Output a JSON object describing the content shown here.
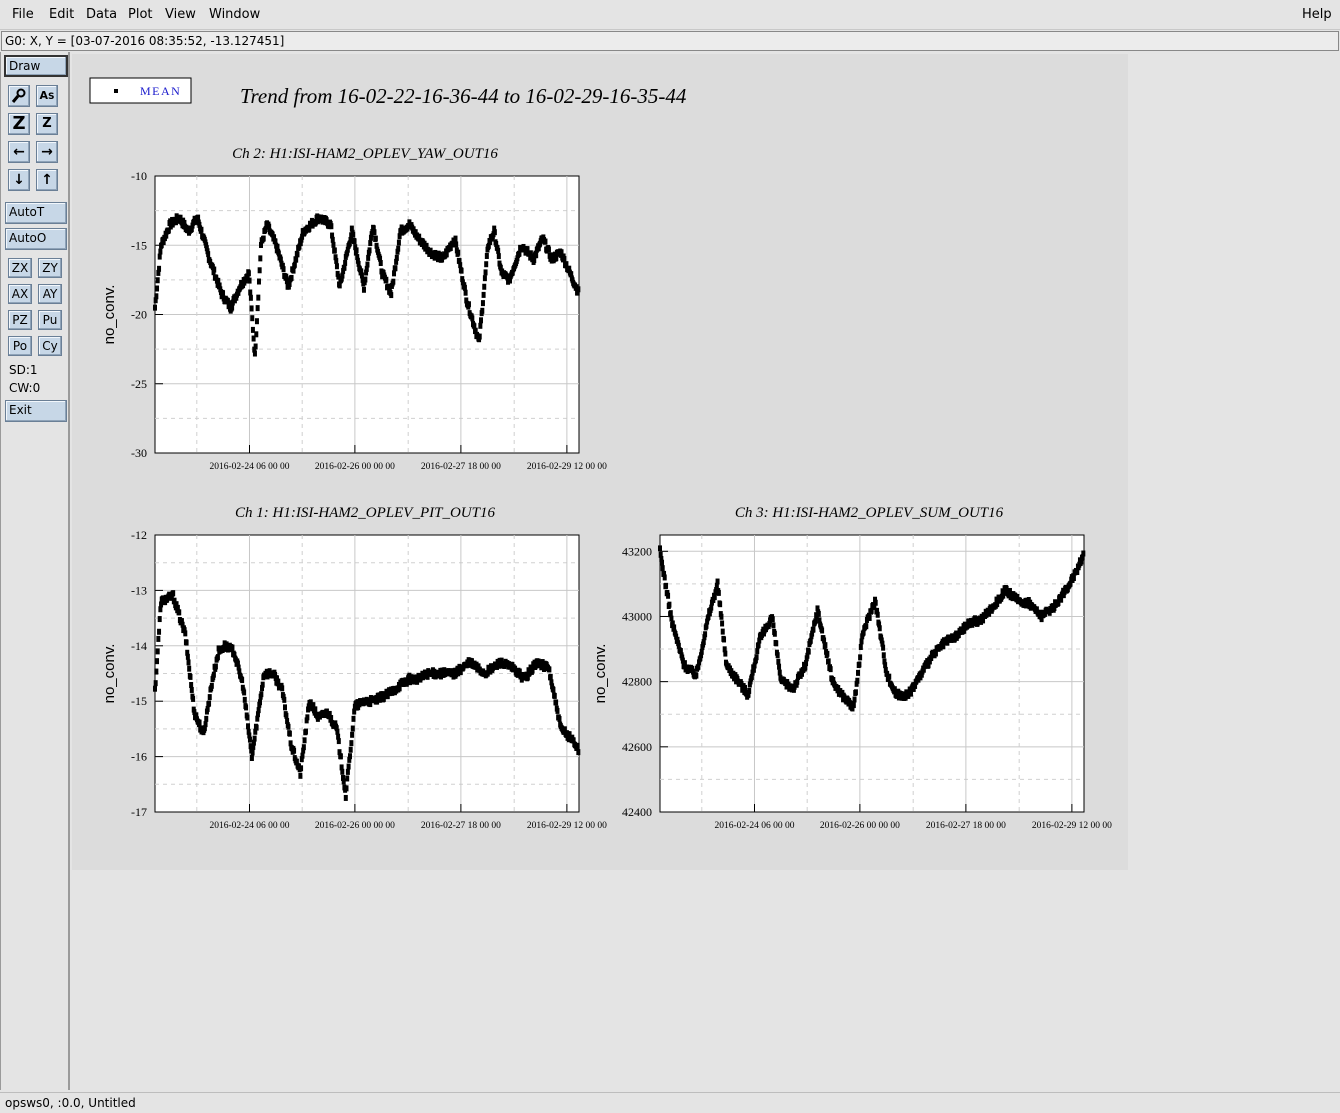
{
  "menu": {
    "file": "File",
    "edit": "Edit",
    "data": "Data",
    "plot": "Plot",
    "view": "View",
    "window": "Window",
    "help": "Help"
  },
  "status_top": "G0: X, Y = [03-07-2016 08:35:52, -13.127451]",
  "status_bottom": "opsws0, :0.0, Untitled",
  "toolbar": {
    "draw": "Draw",
    "icons": [
      "magnifier-icon",
      "autoscale-text-icon",
      "zoom-in-icon",
      "zoom-out-icon",
      "arrow-left-icon",
      "arrow-right-icon",
      "arrow-down-icon",
      "arrow-up-icon"
    ],
    "autot": "AutoT",
    "autoo": "AutoO",
    "zx": "ZX",
    "zy": "ZY",
    "ax": "AX",
    "ay": "AY",
    "pz": "PZ",
    "pu": "Pu",
    "po": "Po",
    "cy": "Cy",
    "sd": "SD:1",
    "cw": "CW:0",
    "exit": "Exit"
  },
  "plot": {
    "title": "Trend from 16-02-22-16-36-44 to 16-02-29-16-35-44",
    "legend": "MEAN"
  },
  "chart_data": [
    {
      "type": "scatter",
      "title": "Ch 2: H1:ISI-HAM2_OPLEV_YAW_OUT16",
      "ylabel": "no_conv.",
      "xlabel": "",
      "xticks": [
        "2016-02-24 06 00 00",
        "2016-02-26 00 00 00",
        "2016-02-27 18 00 00",
        "2016-02-29 12 00 00"
      ],
      "yticks": [
        -10,
        -15,
        -20,
        -25,
        -30
      ],
      "ylim": [
        -30,
        -10
      ],
      "grid": true,
      "series": [
        {
          "name": "MEAN",
          "x_days": [
            0,
            0.1,
            0.25,
            0.4,
            0.55,
            0.7,
            0.9,
            1.1,
            1.25,
            1.4,
            1.55,
            1.65,
            1.75,
            1.85,
            2.0,
            2.2,
            2.45,
            2.7,
            2.9,
            3.05,
            3.25,
            3.45,
            3.6,
            3.75,
            3.9,
            4.05,
            4.2,
            4.35,
            4.55,
            4.75,
            4.95,
            5.15,
            5.35,
            5.5,
            5.6,
            5.72,
            5.85,
            6.05,
            6.25,
            6.4,
            6.55,
            6.7,
            6.85,
            7.0
          ],
          "values": [
            -19.5,
            -15,
            -13.5,
            -13,
            -14,
            -13,
            -16,
            -18.5,
            -19.5,
            -18,
            -17,
            -23,
            -15,
            -13.5,
            -15,
            -18,
            -14,
            -13,
            -13.5,
            -18,
            -14,
            -18,
            -13.5,
            -17,
            -18.5,
            -14,
            -13.5,
            -14.5,
            -15.5,
            -16,
            -14.5,
            -19,
            -22,
            -15,
            -14,
            -17,
            -17.5,
            -15,
            -16,
            -14.5,
            -16,
            -15.5,
            -17,
            -18.5
          ]
        }
      ]
    },
    {
      "type": "scatter",
      "title": "Ch 1: H1:ISI-HAM2_OPLEV_PIT_OUT16",
      "ylabel": "no_conv.",
      "xlabel": "",
      "xticks": [
        "2016-02-24 06 00 00",
        "2016-02-26 00 00 00",
        "2016-02-27 18 00 00",
        "2016-02-29 12 00 00"
      ],
      "yticks": [
        -12,
        -13,
        -14,
        -15,
        -16,
        -17
      ],
      "ylim": [
        -17,
        -12
      ],
      "grid": true,
      "series": [
        {
          "name": "MEAN",
          "x_days": [
            0,
            0.1,
            0.3,
            0.5,
            0.65,
            0.8,
            0.95,
            1.05,
            1.15,
            1.3,
            1.45,
            1.6,
            1.8,
            1.95,
            2.1,
            2.25,
            2.4,
            2.55,
            2.7,
            2.85,
            3.0,
            3.15,
            3.3,
            3.45,
            3.6,
            3.8,
            3.95,
            4.05,
            4.2,
            4.35,
            4.5,
            4.7,
            4.95,
            5.2,
            5.45,
            5.7,
            5.9,
            6.1,
            6.3,
            6.5,
            6.7,
            6.9,
            7.0
          ],
          "values": [
            -14.8,
            -13.2,
            -13.1,
            -13.8,
            -15.2,
            -15.6,
            -14.6,
            -14.1,
            -14,
            -14.1,
            -14.7,
            -16,
            -14.5,
            -14.5,
            -14.8,
            -15.8,
            -16.3,
            -15,
            -15.3,
            -15.2,
            -15.5,
            -16.7,
            -15.1,
            -15,
            -15,
            -14.9,
            -14.8,
            -14.7,
            -14.6,
            -14.6,
            -14.5,
            -14.5,
            -14.5,
            -14.3,
            -14.5,
            -14.3,
            -14.4,
            -14.6,
            -14.3,
            -14.4,
            -15.5,
            -15.7,
            -15.9
          ]
        }
      ]
    },
    {
      "type": "scatter",
      "title": "Ch 3: H1:ISI-HAM2_OPLEV_SUM_OUT16",
      "ylabel": "no_conv.",
      "xlabel": "",
      "xticks": [
        "2016-02-24 06 00 00",
        "2016-02-26 00 00 00",
        "2016-02-27 18 00 00",
        "2016-02-29 12 00 00"
      ],
      "yticks": [
        43200,
        43000,
        42800,
        42600,
        42400
      ],
      "ylim": [
        42400,
        43250
      ],
      "grid": true,
      "series": [
        {
          "name": "MEAN",
          "x_days": [
            0,
            0.2,
            0.4,
            0.6,
            0.8,
            0.95,
            1.1,
            1.3,
            1.45,
            1.65,
            1.85,
            2.0,
            2.2,
            2.4,
            2.6,
            2.85,
            3.0,
            3.2,
            3.35,
            3.55,
            3.75,
            3.9,
            4.1,
            4.3,
            4.5,
            4.7,
            4.9,
            5.1,
            5.3,
            5.5,
            5.7,
            5.9,
            6.1,
            6.3,
            6.5,
            6.7,
            6.9,
            7.0
          ],
          "values": [
            43200,
            42980,
            42850,
            42820,
            43000,
            43100,
            42850,
            42800,
            42760,
            42930,
            43000,
            42800,
            42780,
            42850,
            43020,
            42800,
            42760,
            42720,
            42950,
            43050,
            42820,
            42760,
            42760,
            42820,
            42880,
            42920,
            42940,
            42980,
            42990,
            43030,
            43080,
            43050,
            43040,
            43000,
            43030,
            43080,
            43150,
            43200
          ]
        }
      ]
    }
  ]
}
